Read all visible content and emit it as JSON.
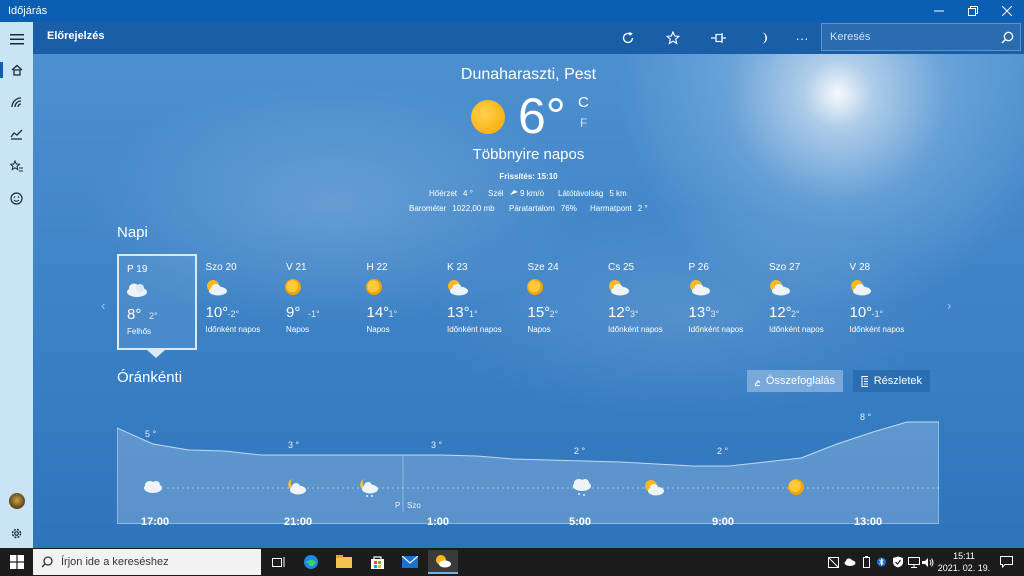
{
  "window": {
    "title": "Időjárás"
  },
  "header": {
    "title": "Előrejelzés",
    "search_placeholder": "Keresés"
  },
  "current": {
    "location": "Dunaharaszti, Pest",
    "temp": "6°",
    "unit_c": "C",
    "unit_f": "F",
    "condition": "Többnyire napos",
    "updated": "Frissítés: 15:10",
    "feels_label": "Hőérzet",
    "feels_value": "4 °",
    "wind_label": "Szél",
    "wind_value": "9 km/ó",
    "visibility_label": "Látótávolság",
    "visibility_value": "5 km",
    "barometer_label": "Barométer",
    "barometer_value": "1022,00 mb",
    "humidity_label": "Páratartalom",
    "humidity_value": "76%",
    "dewpoint_label": "Harmatpont",
    "dewpoint_value": "2 °"
  },
  "daily": {
    "title": "Napi",
    "days": [
      {
        "name": "P 19",
        "hi": "8°",
        "lo": "2°",
        "cond": "Felhős",
        "icon": "cloud-icon"
      },
      {
        "name": "Szo 20",
        "hi": "10°",
        "lo": "-2°",
        "cond": "Időnként napos",
        "icon": "partly-sunny-icon"
      },
      {
        "name": "V 21",
        "hi": "9°",
        "lo": "-1°",
        "cond": "Napos",
        "icon": "sun-icon"
      },
      {
        "name": "H 22",
        "hi": "14°",
        "lo": "1°",
        "cond": "Napos",
        "icon": "sun-icon"
      },
      {
        "name": "K 23",
        "hi": "13°",
        "lo": "1°",
        "cond": "Időnként napos",
        "icon": "partly-sunny-icon"
      },
      {
        "name": "Sze 24",
        "hi": "15°",
        "lo": "2°",
        "cond": "Napos",
        "icon": "sun-icon"
      },
      {
        "name": "Cs 25",
        "hi": "12°",
        "lo": "3°",
        "cond": "Időnként napos",
        "icon": "partly-sunny-icon"
      },
      {
        "name": "P 26",
        "hi": "13°",
        "lo": "3°",
        "cond": "Időnként napos",
        "icon": "partly-sunny-icon"
      },
      {
        "name": "Szo 27",
        "hi": "12°",
        "lo": "2°",
        "cond": "Időnként napos",
        "icon": "partly-sunny-icon"
      },
      {
        "name": "V 28",
        "hi": "10°",
        "lo": "-1°",
        "cond": "Időnként napos",
        "icon": "partly-sunny-icon"
      }
    ]
  },
  "hourly": {
    "title": "Óránkénti",
    "summary_btn": "Összefoglalás",
    "details_btn": "Részletek",
    "day_marker_a": "P",
    "day_marker_b": "Szo",
    "temps": [
      "5 °",
      "3 °",
      "3 °",
      "2 °",
      "2 °",
      "8 °"
    ],
    "times": [
      "17:00",
      "21:00",
      "1:00",
      "5:00",
      "9:00",
      "13:00"
    ]
  },
  "taskbar": {
    "search_placeholder": "Írjon ide a kereséshez",
    "time": "15:11",
    "date": "2021. 02. 19."
  }
}
